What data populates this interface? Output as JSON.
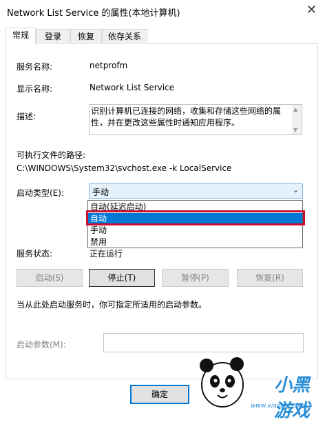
{
  "window": {
    "title": "Network List Service 的属性(本地计算机)",
    "close_glyph": "✕"
  },
  "tabs": [
    {
      "label": "常规"
    },
    {
      "label": "登录"
    },
    {
      "label": "恢复"
    },
    {
      "label": "依存关系"
    }
  ],
  "general": {
    "service_name_label": "服务名称:",
    "service_name_value": "netprofm",
    "display_name_label": "显示名称:",
    "display_name_value": "Network List Service",
    "description_label": "描述:",
    "description_value": "识别计算机已连接的网络，收集和存储这些网络的属性，并在更改这些属性时通知应用程序。",
    "exe_path_label": "可执行文件的路径:",
    "exe_path_value": "C:\\WINDOWS\\System32\\svchost.exe -k LocalService",
    "startup_type_label": "启动类型(E):",
    "startup_type_selected": "手动",
    "startup_options": [
      "自动(延迟启动)",
      "自动",
      "手动",
      "禁用"
    ],
    "highlighted_option_index": 1,
    "service_status_label": "服务状态:",
    "service_status_value": "正在运行",
    "buttons": {
      "start": "启动(S)",
      "stop": "停止(T)",
      "pause": "暂停(P)",
      "resume": "恢复(R)"
    },
    "hint_text": "当从此处启动服务时，你可指定所适用的启动参数。",
    "start_params_label": "启动参数(M):",
    "start_params_value": ""
  },
  "footer": {
    "ok_label": "确定"
  },
  "watermark": {
    "text": "小黑游戏",
    "url": "www.xiaohei.com"
  },
  "colors": {
    "selection_blue": "#0078d7",
    "highlight_red": "#c8102e",
    "watermark_blue": "#2a8fd6"
  }
}
